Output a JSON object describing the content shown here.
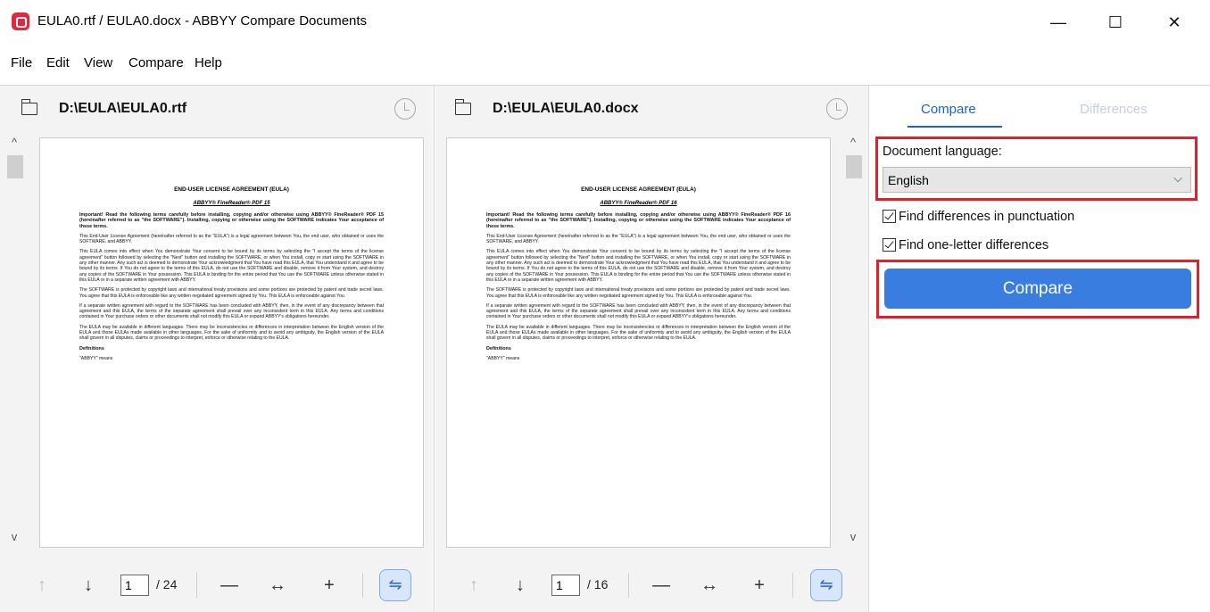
{
  "window": {
    "title": "EULA0.rtf / EULA0.docx - ABBYY Compare Documents",
    "minimize_glyph": "—",
    "maximize_glyph": "☐",
    "close_glyph": "✕"
  },
  "menu": [
    "File",
    "Edit",
    "View",
    "Compare",
    "Help"
  ],
  "left_pane": {
    "path": "D:\\EULA\\EULA0.rtf",
    "page_current": "1",
    "page_total": "/ 24"
  },
  "right_pane": {
    "path": "D:\\EULA\\EULA0.docx",
    "page_current": "1",
    "page_total": "/ 16"
  },
  "document": {
    "title": "END-USER LICENSE AGREEMENT (EULA)",
    "subtitle_left": "ABBYY® FineReader® PDF 15",
    "subtitle_right": "ABBYY® FineReader® PDF 16",
    "intro_left": "Important! Read the following terms carefully before installing, copying and/or otherwise using ABBYY® FineReader® PDF 15 (hereinafter referred to as \"the SOFTWARE\"). Installing, copying or otherwise using the SOFTWARE indicates Your acceptance of these terms.",
    "intro_right": "Important! Read the following terms carefully before installing, copying and/or otherwise using ABBYY® FineReader® PDF 16 (hereinafter referred to as \"the SOFTWARE\"). Installing, copying or otherwise using the SOFTWARE indicates Your acceptance of these terms.",
    "p1": "This End-User License Agreement (hereinafter referred to as the \"EULA\") is a legal agreement between You, the end user, who obtained or uses the SOFTWARE, and ABBYY.",
    "p2": "This EULA comes into effect when You demonstrate Your consent to be bound by its terms by selecting the \"I accept the terms of the license agreement\" button followed by selecting the \"Next\" button and installing the SOFTWARE, or when You install, copy or start using the SOFTWARE in any other manner. Any such act is deemed to demonstrate Your acknowledgment that You have read this EULA, that You understand it and agree to be bound by its terms. If You do not agree to the terms of this EULA, do not use the SOFTWARE and disable, remove it from Your system, and destroy any copies of the SOFTWARE in Your possession. This EULA is binding for the entire period that You use the SOFTWARE unless otherwise stated in this EULA or in a separate written agreement with ABBYY.",
    "p3": "The SOFTWARE is protected by copyright laws and international treaty provisions and some portions are protected by patent and trade secret laws. You agree that this EULA is enforceable like any written negotiated agreement signed by You. This EULA is enforceable against You.",
    "p4": "If a separate written agreement with regard to the SOFTWARE has been concluded with ABBYY, then, in the event of any discrepancy between that agreement and this EULA, the terms of the separate agreement shall prevail over any inconsistent term in this EULA. Any terms and conditions contained in Your purchase orders or other documents shall not modify this EULA or expand ABBYY's obligations hereunder.",
    "p5": "The EULA may be available in different languages. There may be inconsistencies or differences in interpretation between the English version of the EULA and those EULAs made available in other languages. For the sake of uniformity and to avoid any ambiguity, the English version of the EULA shall govern in all disputes, claims or proceedings to interpret, enforce or otherwise relating to the EULA.",
    "definitions": "Definitions",
    "abbyy_means": "\"ABBYY\" means"
  },
  "side_panel": {
    "tab_compare": "Compare",
    "tab_differences": "Differences",
    "language_label": "Document language:",
    "language_value": "English",
    "check_punctuation": "Find differences in punctuation",
    "check_one_letter": "Find one-letter differences",
    "compare_button": "Compare",
    "highlight_color": "#e0202a",
    "accent_color": "#3a7de0"
  },
  "icons": {
    "up_arrow": "↑",
    "down_arrow": "↓",
    "zoom_out": "—",
    "fit_width": "↔",
    "zoom_in": "+",
    "sync": "⇋",
    "scroll_up": "^",
    "scroll_down": "v",
    "dropdown": "⌵"
  }
}
